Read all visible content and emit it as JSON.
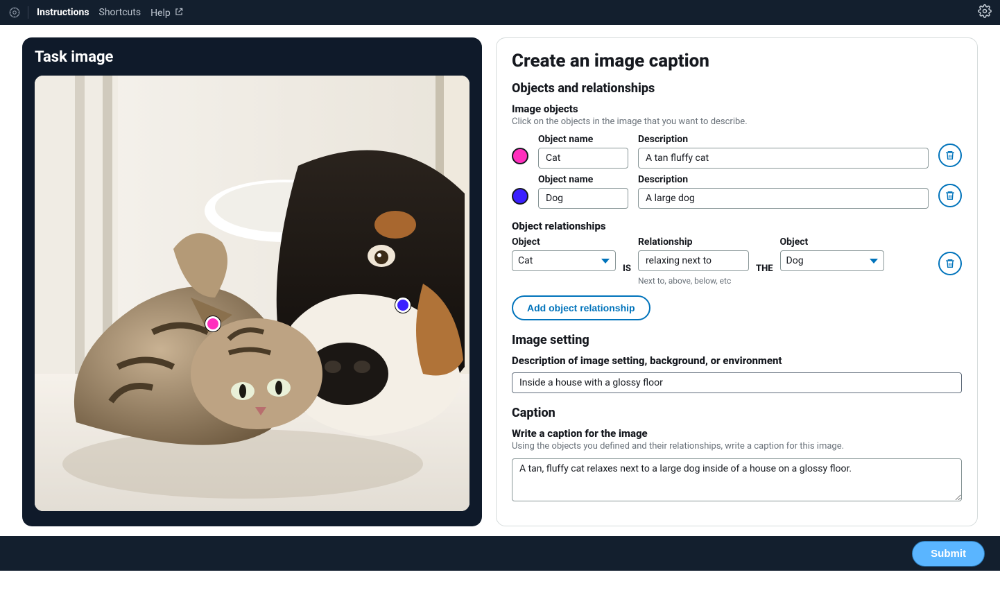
{
  "topbar": {
    "links": {
      "instructions": "Instructions",
      "shortcuts": "Shortcuts",
      "help": "Help"
    }
  },
  "left_panel": {
    "title": "Task image",
    "markers": [
      {
        "color": "pink",
        "linked_object_index": 0
      },
      {
        "color": "blue",
        "linked_object_index": 1
      }
    ]
  },
  "form": {
    "title": "Create an image caption",
    "sections": {
      "objects_relationships": {
        "heading": "Objects and relationships",
        "image_objects_label": "Image objects",
        "image_objects_hint": "Click on the objects in the image that you want to describe.",
        "object_name_label": "Object name",
        "description_label": "Description",
        "objects": [
          {
            "marker_color": "pink",
            "name": "Cat",
            "description": "A tan fluffy cat"
          },
          {
            "marker_color": "blue",
            "name": "Dog",
            "description": "A large dog"
          }
        ],
        "relationships_label": "Object relationships",
        "rel_object_label": "Object",
        "rel_relationship_label": "Relationship",
        "connector_is": "IS",
        "connector_the": "THE",
        "relationship_hint": "Next to, above, below, etc",
        "relationships": [
          {
            "subject": "Cat",
            "relationship": "relaxing next to",
            "object": "Dog"
          }
        ],
        "add_button": "Add object relationship"
      },
      "image_setting": {
        "heading": "Image setting",
        "label": "Description of image setting, background, or environment",
        "value": "Inside a house with a glossy floor"
      },
      "caption": {
        "heading": "Caption",
        "label": "Write a caption for the image",
        "hint": "Using the objects you defined and their relationships, write a caption for this image.",
        "value": "A tan, fluffy cat relaxes next to a large dog inside of a house on a glossy floor."
      }
    }
  },
  "bottombar": {
    "submit": "Submit"
  }
}
